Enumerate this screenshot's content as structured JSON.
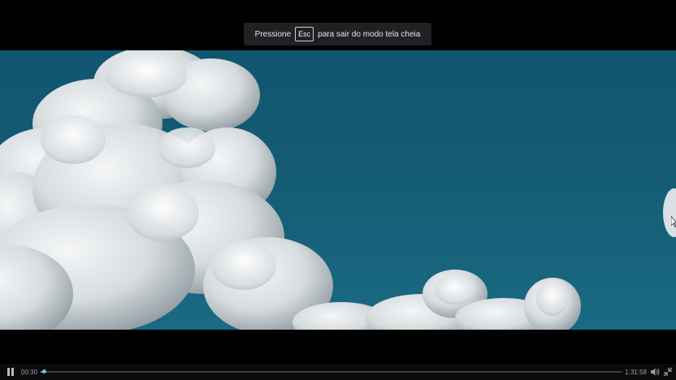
{
  "toast": {
    "before": "Pressione",
    "key": "Esc",
    "after": "para sair do modo tela cheia"
  },
  "player": {
    "current_time": "00:30",
    "duration": "1:31:58",
    "progress": 0.0054,
    "state": "playing"
  },
  "icons": {
    "pause": "pause-icon",
    "volume": "volume-icon",
    "fullscreen": "exit-fullscreen-icon"
  },
  "colors": {
    "sky": "#145c74",
    "progress": "#5b9ec5",
    "toast_bg": "#202124"
  }
}
